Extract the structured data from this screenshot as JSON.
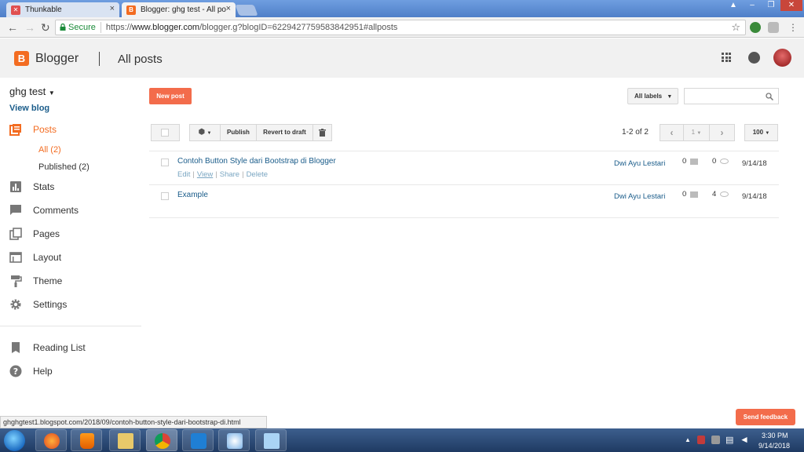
{
  "browser": {
    "tabs": [
      {
        "title": "Thunkable"
      },
      {
        "title": "Blogger: ghg test - All po"
      }
    ],
    "address": {
      "secure_label": "Secure",
      "url_prefix": "https://",
      "url_host": "www.blogger.com",
      "url_path": "/blogger.g?blogID=6229427759583842951#allposts"
    },
    "status_url": "ghghgtest1.blogspot.com/2018/09/contoh-button-style-dari-bootstrap-di.html"
  },
  "header": {
    "app_name": "Blogger",
    "page_title": "All posts"
  },
  "sidebar": {
    "blog_title": "ghg test",
    "view_blog": "View blog",
    "items": [
      {
        "label": "Posts"
      },
      {
        "label": "Stats"
      },
      {
        "label": "Comments"
      },
      {
        "label": "Pages"
      },
      {
        "label": "Layout"
      },
      {
        "label": "Theme"
      },
      {
        "label": "Settings"
      },
      {
        "label": "Reading List"
      },
      {
        "label": "Help"
      }
    ],
    "posts_sub": [
      {
        "label": "All (2)"
      },
      {
        "label": "Published (2)"
      }
    ]
  },
  "toolbar": {
    "new_post": "New post",
    "all_labels": "All labels",
    "publish": "Publish",
    "revert": "Revert to draft",
    "page_info": "1-2 of 2",
    "page_number": "1",
    "per_page": "100"
  },
  "posts": [
    {
      "title": "Contoh Button Style dari Bootstrap di Blogger",
      "author": "Dwi Ayu Lestari",
      "comments": "0",
      "views": "0",
      "date": "9/14/18",
      "actions": [
        "Edit",
        "View",
        "Share",
        "Delete"
      ]
    },
    {
      "title": "Example",
      "author": "Dwi Ayu Lestari",
      "comments": "0",
      "views": "4",
      "date": "9/14/18"
    }
  ],
  "feedback": "Send feedback",
  "taskbar": {
    "time": "3:30 PM",
    "date": "9/14/2018"
  },
  "colors": {
    "accent": "#f36c4b",
    "blogger_orange": "#f36c21",
    "link": "#1a5c8a"
  }
}
